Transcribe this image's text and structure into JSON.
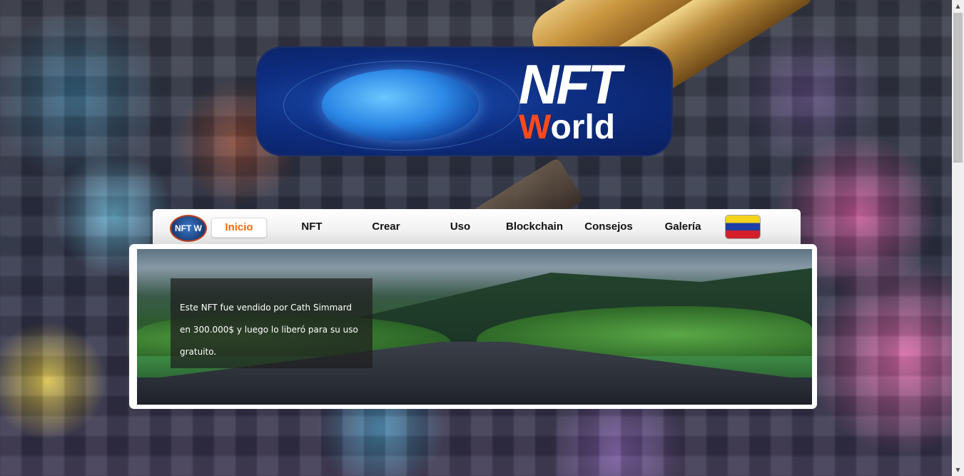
{
  "logo": {
    "title_line1": "NFT",
    "title_line2_first": "W",
    "title_line2_rest": "orld",
    "accent_color": "#ff4a1c"
  },
  "nav": {
    "logo_text": "NFT W",
    "items": [
      {
        "label": "Inicio",
        "active": true
      },
      {
        "label": "NFT",
        "active": false
      },
      {
        "label": "Crear",
        "active": false
      },
      {
        "label": "Uso",
        "active": false
      },
      {
        "label": "Blockchain",
        "active": false
      },
      {
        "label": "Consejos",
        "active": false
      },
      {
        "label": "Galería",
        "active": false
      }
    ],
    "active_color": "#ff6a00",
    "flag_icon": "flag-icon"
  },
  "slider": {
    "caption": "Este NFT fue vendido por Cath Simmard en 300.000$ y luego lo liberó para su uso gratuito."
  },
  "scrollbar": {
    "up_icon": "▲",
    "down_icon": "▼"
  }
}
